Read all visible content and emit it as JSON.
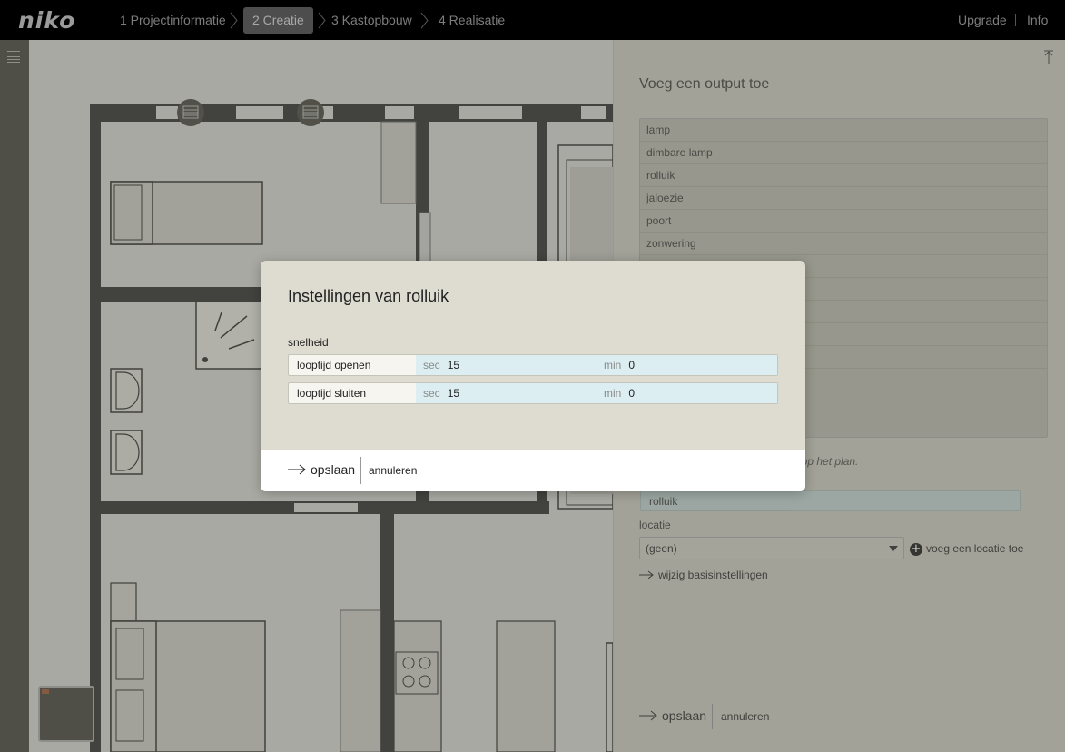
{
  "brand": {
    "logo": "niko"
  },
  "steps": [
    {
      "label": "1 Projectinformatie"
    },
    {
      "label": "2 Creatie"
    },
    {
      "label": "3 Kastopbouw"
    },
    {
      "label": "4 Realisatie"
    }
  ],
  "topright": {
    "upgrade": "Upgrade",
    "info": "Info"
  },
  "panel": {
    "title": "Voeg een output toe",
    "outputs": [
      "lamp",
      "dimbare lamp",
      "rolluik",
      "jaloezie",
      "poort",
      "zonwering",
      "",
      "",
      "",
      "",
      "",
      "",
      ""
    ],
    "hint": "ts op het plan.",
    "name_value": "rolluik",
    "location_label": "locatie",
    "location_value": "(geen)",
    "add_location": "voeg een locatie toe",
    "change_basic": "wijzig basisinstellingen",
    "save": "opslaan",
    "cancel": "annuleren"
  },
  "modal": {
    "title": "Instellingen van rolluik",
    "section": "snelheid",
    "rows": [
      {
        "label": "looptijd openen",
        "sec_unit": "sec",
        "sec_value": "15",
        "min_unit": "min",
        "min_value": "0"
      },
      {
        "label": "looptijd sluiten",
        "sec_unit": "sec",
        "sec_value": "15",
        "min_unit": "min",
        "min_value": "0"
      }
    ],
    "save": "opslaan",
    "cancel": "annuleren"
  },
  "colors": {
    "topbar": "#000000",
    "active_step": "#4d4d4d",
    "field_bg": "#ddeef3"
  }
}
